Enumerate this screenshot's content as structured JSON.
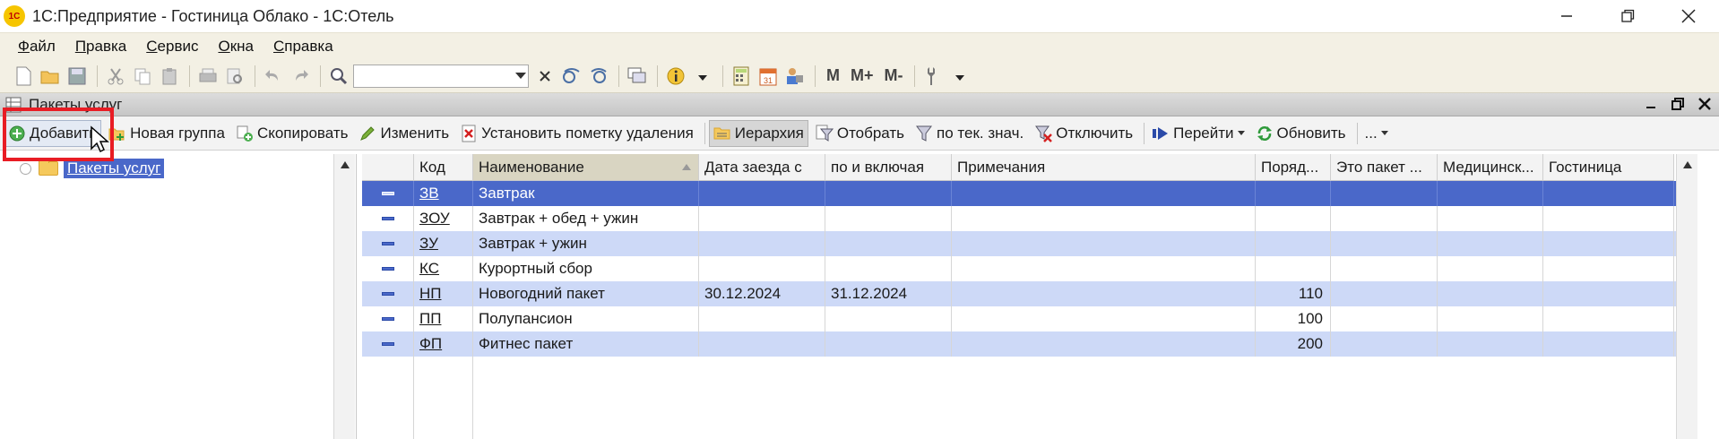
{
  "window": {
    "logo_text": "1С",
    "title": "1С:Предприятие - Гостиница Облако - 1С:Отель"
  },
  "menu": {
    "items": [
      {
        "first": "Ф",
        "rest": "айл"
      },
      {
        "first": "П",
        "rest": "равка"
      },
      {
        "first": "С",
        "rest": "ервис"
      },
      {
        "first": "О",
        "rest": "кна"
      },
      {
        "first": "С",
        "rest": "правка"
      }
    ]
  },
  "toolbar": {
    "search_value": "",
    "m_label": "M",
    "mplus_label": "M+",
    "mminus_label": "M-"
  },
  "subwindow": {
    "title": "Пакеты услуг"
  },
  "commands": {
    "add": "Добавить",
    "new_group": "Новая группа",
    "copy": "Скопировать",
    "edit": "Изменить",
    "mark_delete": "Установить пометку удаления",
    "hierarchy": "Иерархия",
    "filter": "Отобрать",
    "filter_current": "по тек. знач.",
    "disable_filter": "Отключить",
    "goto": "Перейти",
    "refresh": "Обновить",
    "more": "..."
  },
  "tree": {
    "root_label": "Пакеты услуг"
  },
  "grid": {
    "columns": [
      "Код",
      "Наименование",
      "Дата заезда с",
      "по и включая",
      "Примечания",
      "Поряд...",
      "Это пакет ...",
      "Медицинск...",
      "Гостиница"
    ],
    "rows": [
      {
        "code": "ЗВ",
        "name": "Завтрак",
        "date_from": "",
        "date_to": "",
        "notes": "",
        "order": "",
        "is_package": "",
        "medical": "",
        "hotel": ""
      },
      {
        "code": "ЗОУ",
        "name": "Завтрак + обед + ужин",
        "date_from": "",
        "date_to": "",
        "notes": "",
        "order": "",
        "is_package": "",
        "medical": "",
        "hotel": ""
      },
      {
        "code": "ЗУ",
        "name": "Завтрак + ужин",
        "date_from": "",
        "date_to": "",
        "notes": "",
        "order": "",
        "is_package": "",
        "medical": "",
        "hotel": ""
      },
      {
        "code": "КС",
        "name": "Курортный сбор",
        "date_from": "",
        "date_to": "",
        "notes": "",
        "order": "",
        "is_package": "",
        "medical": "",
        "hotel": ""
      },
      {
        "code": "НП",
        "name": "Новогодний пакет",
        "date_from": "30.12.2024",
        "date_to": "31.12.2024",
        "notes": "",
        "order": "110",
        "is_package": "",
        "medical": "",
        "hotel": ""
      },
      {
        "code": "ПП",
        "name": "Полупансион",
        "date_from": "",
        "date_to": "",
        "notes": "",
        "order": "100",
        "is_package": "",
        "medical": "",
        "hotel": ""
      },
      {
        "code": "ФП",
        "name": "Фитнес пакет",
        "date_from": "",
        "date_to": "",
        "notes": "",
        "order": "200",
        "is_package": "",
        "medical": "",
        "hotel": ""
      }
    ]
  },
  "colors": {
    "selected_row": "#4a68c9",
    "alt_row": "#cdd9f7",
    "highlight": "#e81c24"
  }
}
